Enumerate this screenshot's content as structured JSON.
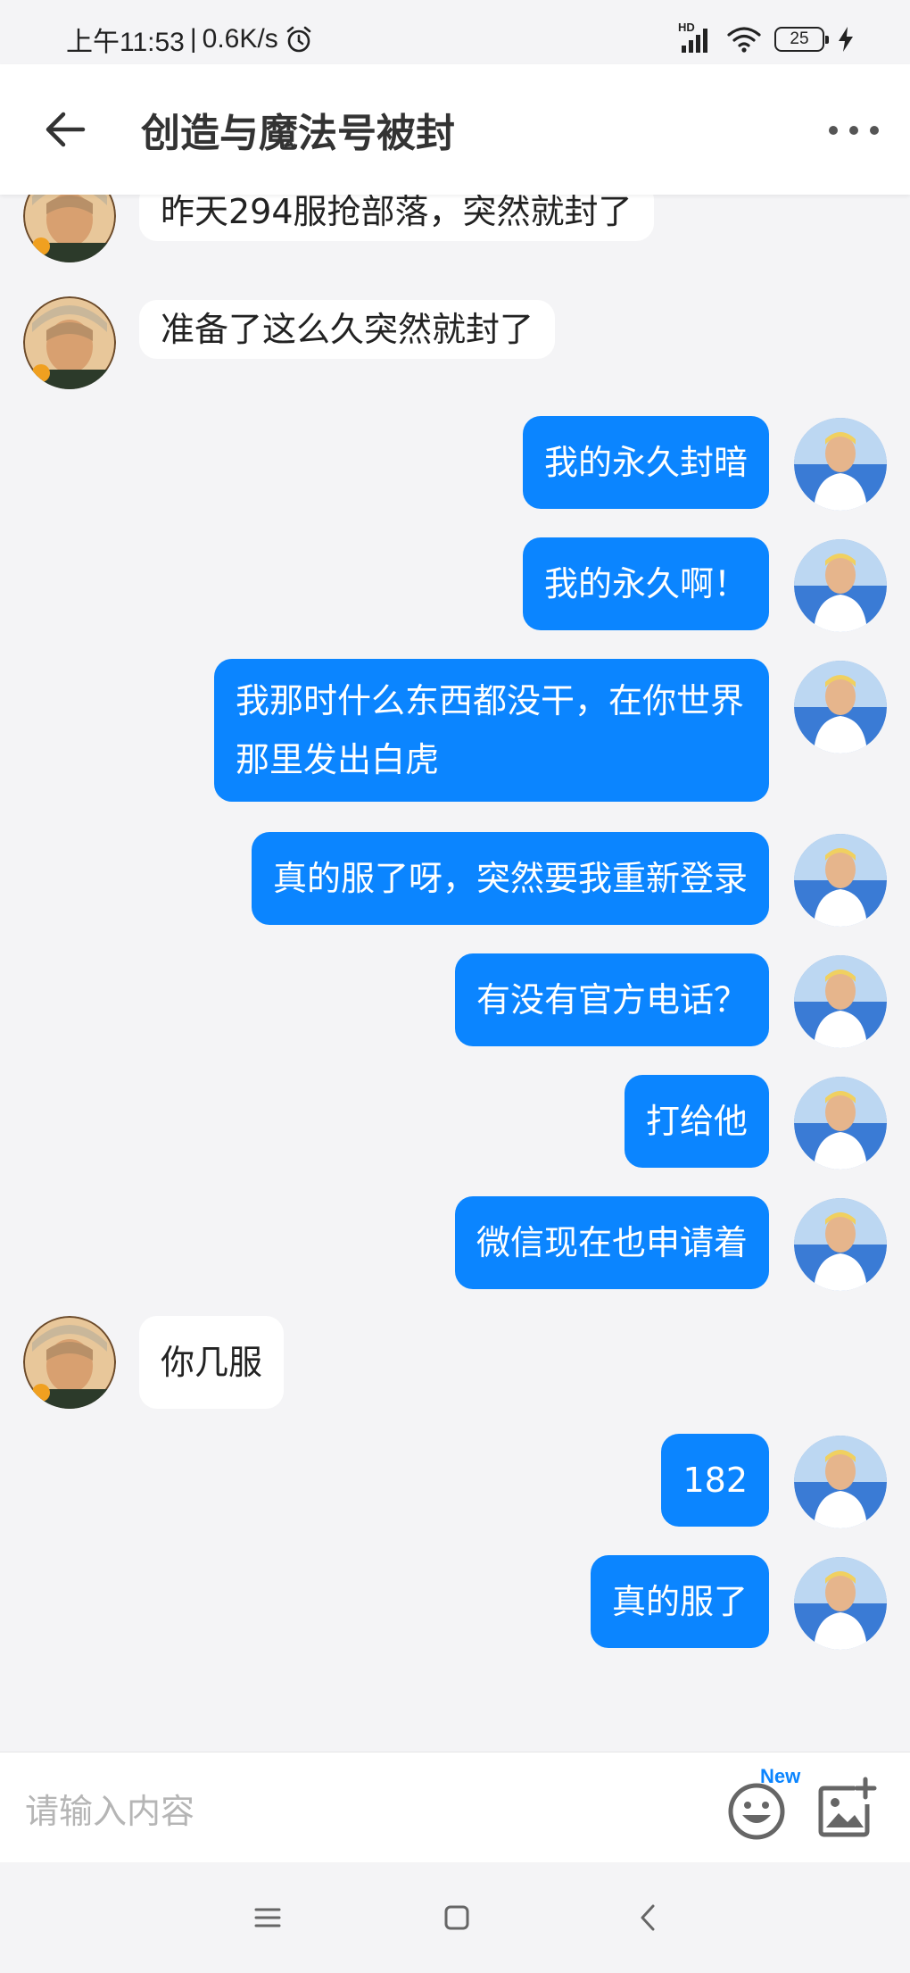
{
  "status_bar": {
    "time": "上午11:53",
    "separator": "|",
    "net_speed": "0.6K/s",
    "signal_label": "HD",
    "battery": "25",
    "icons": [
      "alarm-icon",
      "signal-icon",
      "wifi-icon",
      "battery-icon",
      "charging-icon"
    ]
  },
  "header": {
    "title": "创造与魔法号被封",
    "back_icon": "arrow-left-icon",
    "more_icon": "more-dots-icon"
  },
  "messages": [
    {
      "side": "in",
      "text": "昨天294服抢部落，突然就封了"
    },
    {
      "side": "in",
      "text": "准备了这么久突然就封了"
    },
    {
      "side": "out",
      "text": "我的永久封暗"
    },
    {
      "side": "out",
      "text": "我的永久啊！"
    },
    {
      "side": "out",
      "text": "我那时什么东西都没干，在你世界那里发出白虎"
    },
    {
      "side": "out",
      "text": "真的服了呀，突然要我重新登录"
    },
    {
      "side": "out",
      "text": "有没有官方电话？"
    },
    {
      "side": "out",
      "text": "打给他"
    },
    {
      "side": "out",
      "text": "微信现在也申请着"
    },
    {
      "side": "in",
      "text": "你几服"
    },
    {
      "side": "out",
      "text": "182"
    },
    {
      "side": "out",
      "text": "真的服了"
    }
  ],
  "input": {
    "placeholder": "请输入内容",
    "emoji_icon": "emoji-icon",
    "new_badge": "New",
    "image_icon": "add-image-icon"
  },
  "nav": {
    "icons": [
      "menu-icon",
      "home-icon",
      "back-icon"
    ]
  },
  "colors": {
    "accent": "#0b85ff",
    "background": "#f4f4f6",
    "bubble_in": "#ffffff"
  }
}
